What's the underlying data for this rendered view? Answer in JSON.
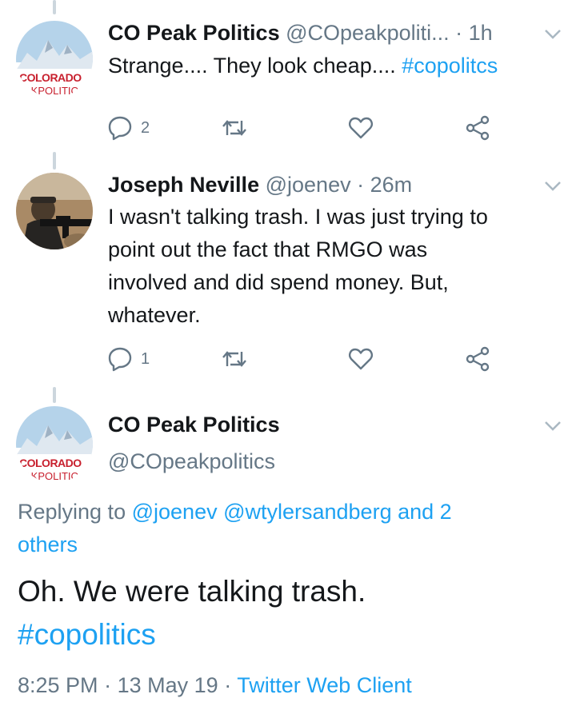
{
  "tweets": [
    {
      "name": "CO Peak Politics",
      "handle": "@COpeakpoliti...",
      "sep": "·",
      "time": "1h",
      "text": "Strange.... They look cheap....",
      "hashtag": "#copolitcs",
      "replies": "2",
      "avatar_text_top": "COLORADO",
      "avatar_text_bottom": "AKPOLITIC"
    },
    {
      "name": "Joseph Neville",
      "handle": "@joenev",
      "sep": "·",
      "time": "26m",
      "text_lines": [
        "I wasn't talking trash. I was just trying to",
        "point out the fact that RMGO was",
        "involved and did spend money. But,",
        "whatever."
      ],
      "replies": "1"
    }
  ],
  "main_tweet": {
    "name": "CO Peak Politics",
    "handle": "@COpeakpolitics",
    "avatar_text_top": "COLORADO",
    "avatar_text_bottom": "AKPOLITIC",
    "replying_prefix": "Replying to",
    "replying_users": "@joenev @wtylersandberg and 2",
    "replying_others": "others",
    "text": "Oh. We were talking trash.",
    "hashtag": "#copolitics",
    "time": "8:25 PM",
    "date": "13 May 19",
    "sep": "·",
    "client": "Twitter Web Client"
  },
  "colors": {
    "link": "#1da1f2",
    "muted": "#657786",
    "text": "#14171a",
    "thread_line": "#ccd6dd",
    "logo_red": "#c8202e"
  },
  "icons": [
    "reply-icon",
    "retweet-icon",
    "like-icon",
    "share-icon",
    "chevron-down-icon"
  ]
}
